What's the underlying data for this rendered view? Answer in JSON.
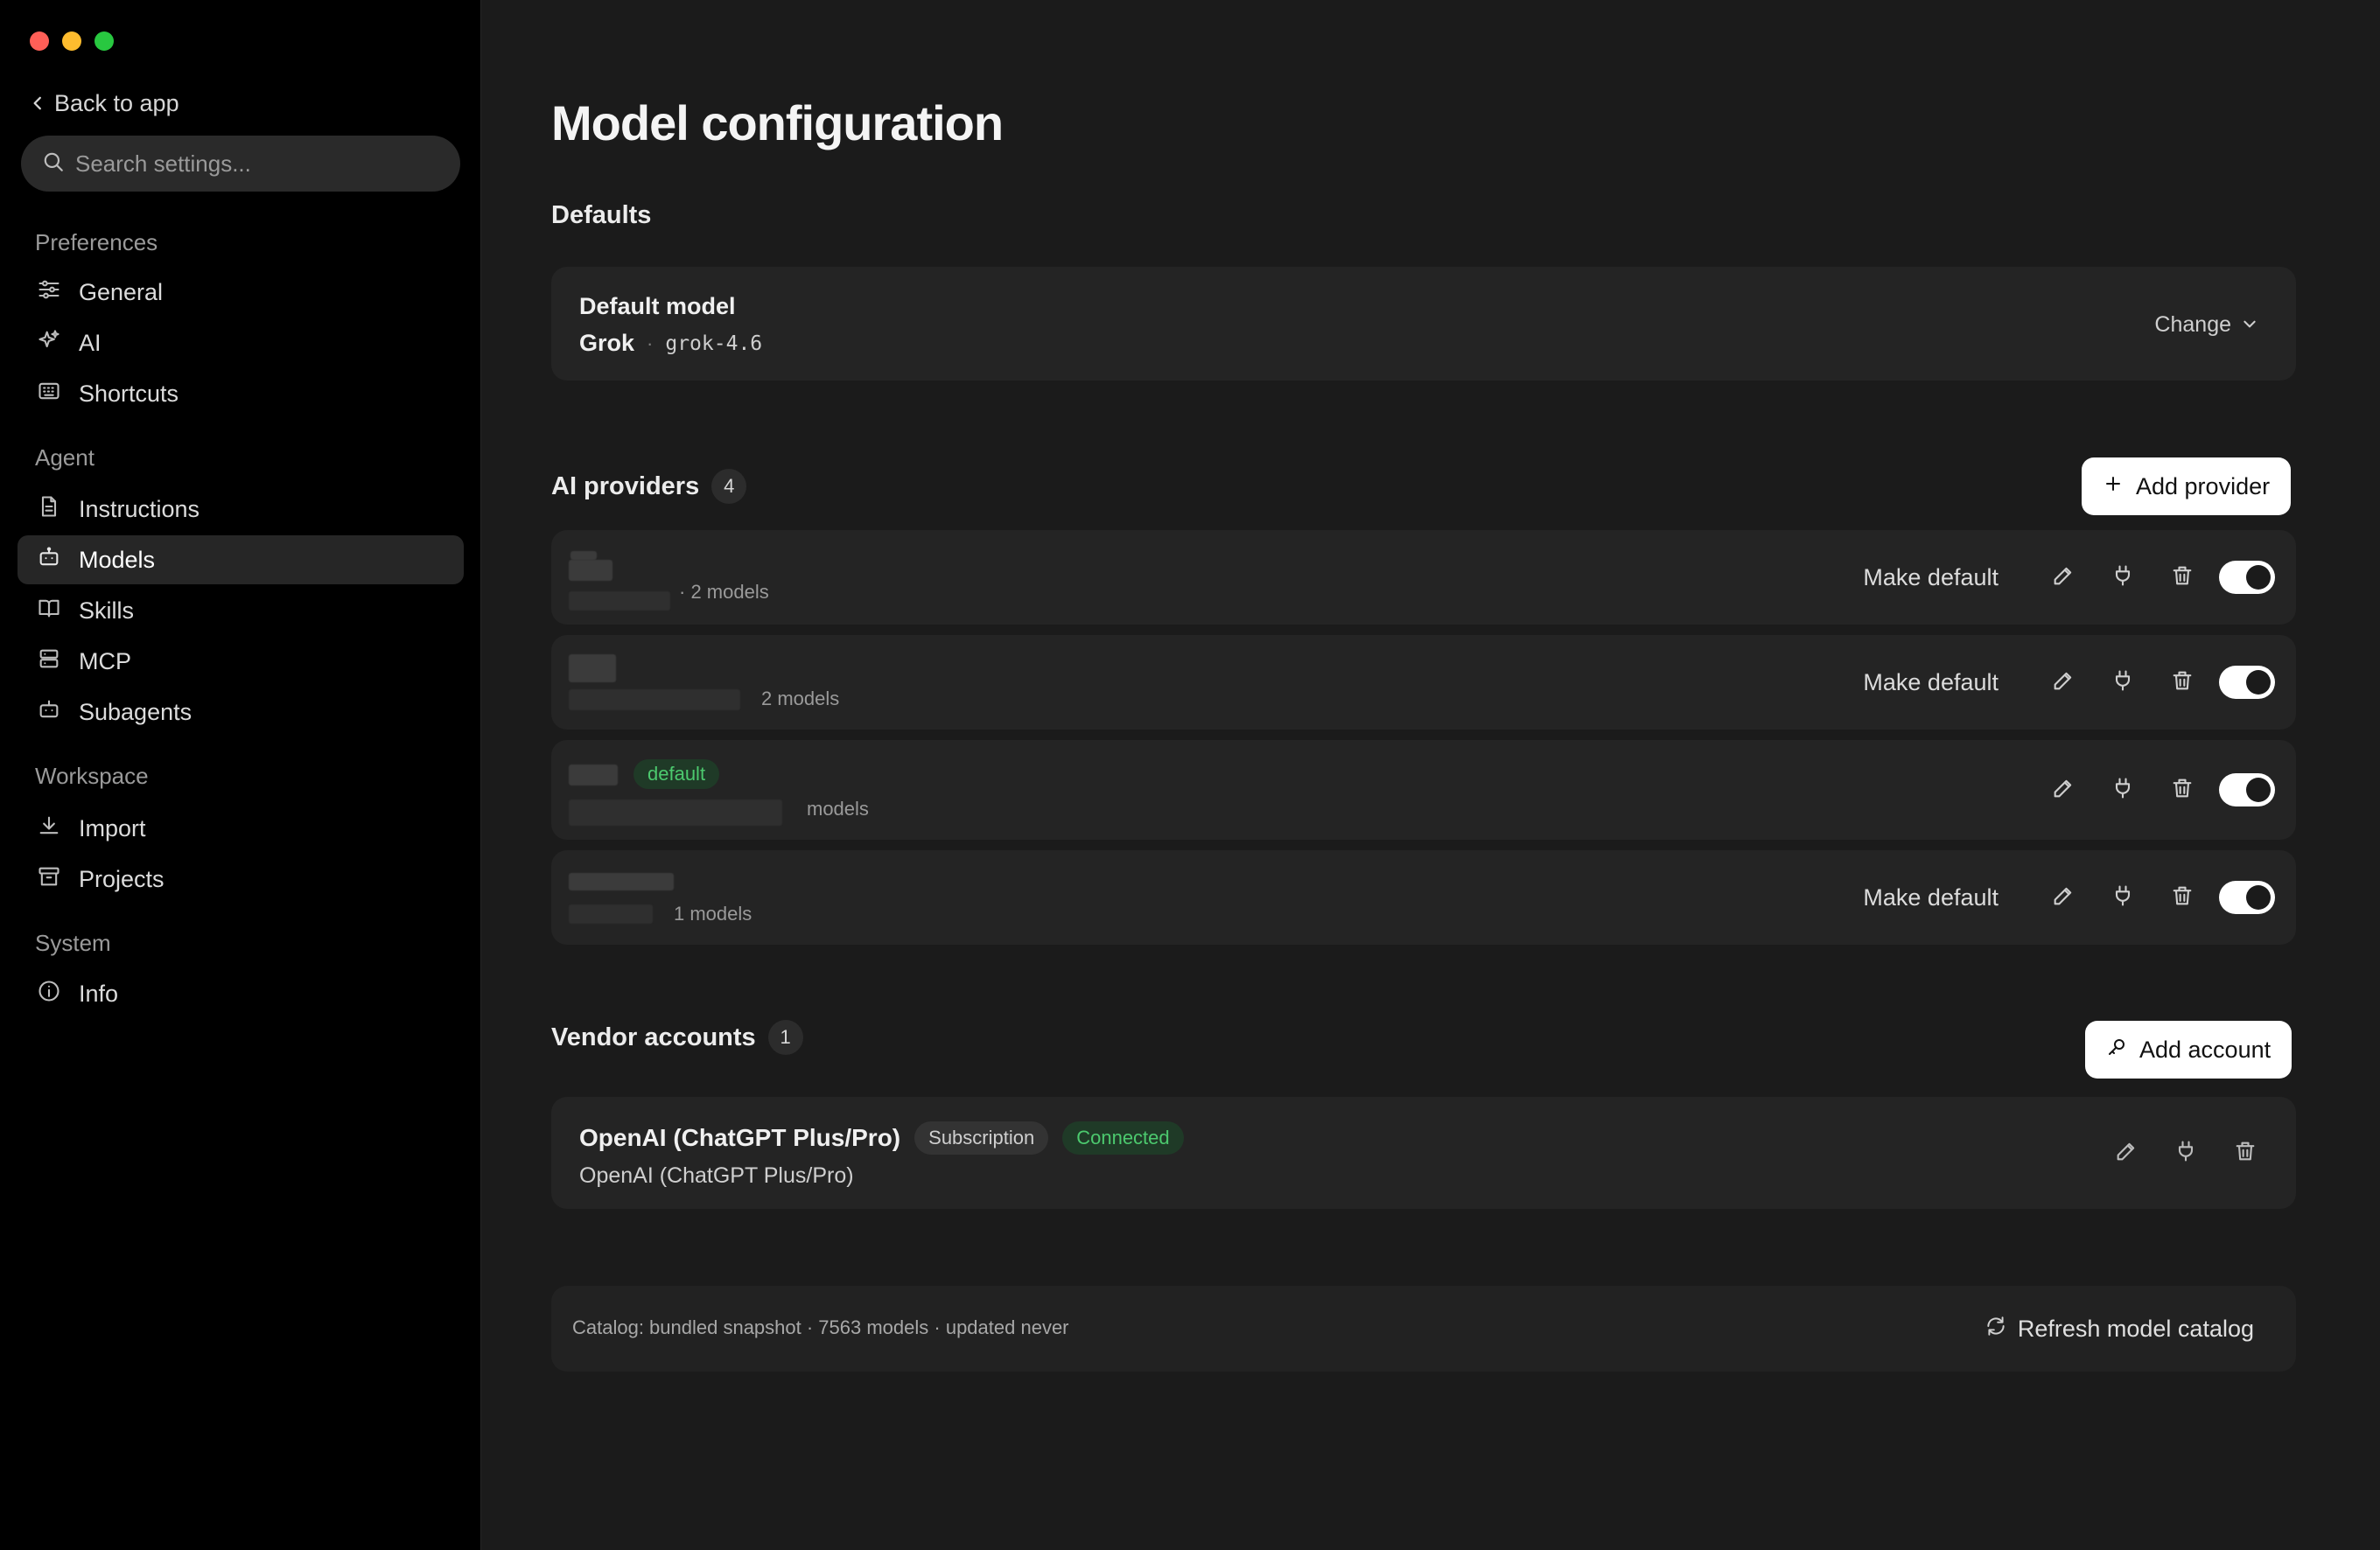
{
  "sidebar": {
    "back_label": "Back to app",
    "search_placeholder": "Search settings...",
    "sections": {
      "preferences": "Preferences",
      "agent": "Agent",
      "workspace": "Workspace",
      "system": "System"
    },
    "items": {
      "general": "General",
      "ai": "AI",
      "shortcuts": "Shortcuts",
      "instructions": "Instructions",
      "models": "Models",
      "skills": "Skills",
      "mcp": "MCP",
      "subagents": "Subagents",
      "import": "Import",
      "projects": "Projects",
      "info": "Info"
    },
    "active_item": "Models"
  },
  "main": {
    "title": "Model configuration",
    "defaults": {
      "heading": "Defaults",
      "label": "Default model",
      "provider": "Grok",
      "separator": "·",
      "model": "grok-4.6",
      "change_label": "Change"
    },
    "providers": {
      "heading": "AI providers",
      "count": "4",
      "add_label": "Add provider",
      "make_default_label": "Make default",
      "rows": [
        {
          "models": "· 2 models",
          "is_default": false,
          "enabled": true
        },
        {
          "models": "2 models",
          "is_default": false,
          "enabled": true
        },
        {
          "models": "models",
          "is_default": true,
          "default_tag": "default",
          "enabled": true
        },
        {
          "models": "1 models",
          "is_default": false,
          "enabled": true
        }
      ]
    },
    "vendors": {
      "heading": "Vendor accounts",
      "count": "1",
      "add_label": "Add account",
      "rows": [
        {
          "name": "OpenAI (ChatGPT Plus/Pro)",
          "plan_badge": "Subscription",
          "status_badge": "Connected",
          "subtitle": "OpenAI (ChatGPT Plus/Pro)"
        }
      ]
    },
    "catalog": {
      "text": "Catalog: bundled snapshot · 7563 models · updated never",
      "refresh_label": "Refresh model catalog"
    }
  },
  "colors": {
    "window_bg": "#1b1b1b",
    "sidebar_bg": "#000000",
    "card_bg": "#242424",
    "accent_green": "#4cc96e",
    "traffic_red": "#fe5f57",
    "traffic_yellow": "#febc2e",
    "traffic_green": "#28c840"
  }
}
